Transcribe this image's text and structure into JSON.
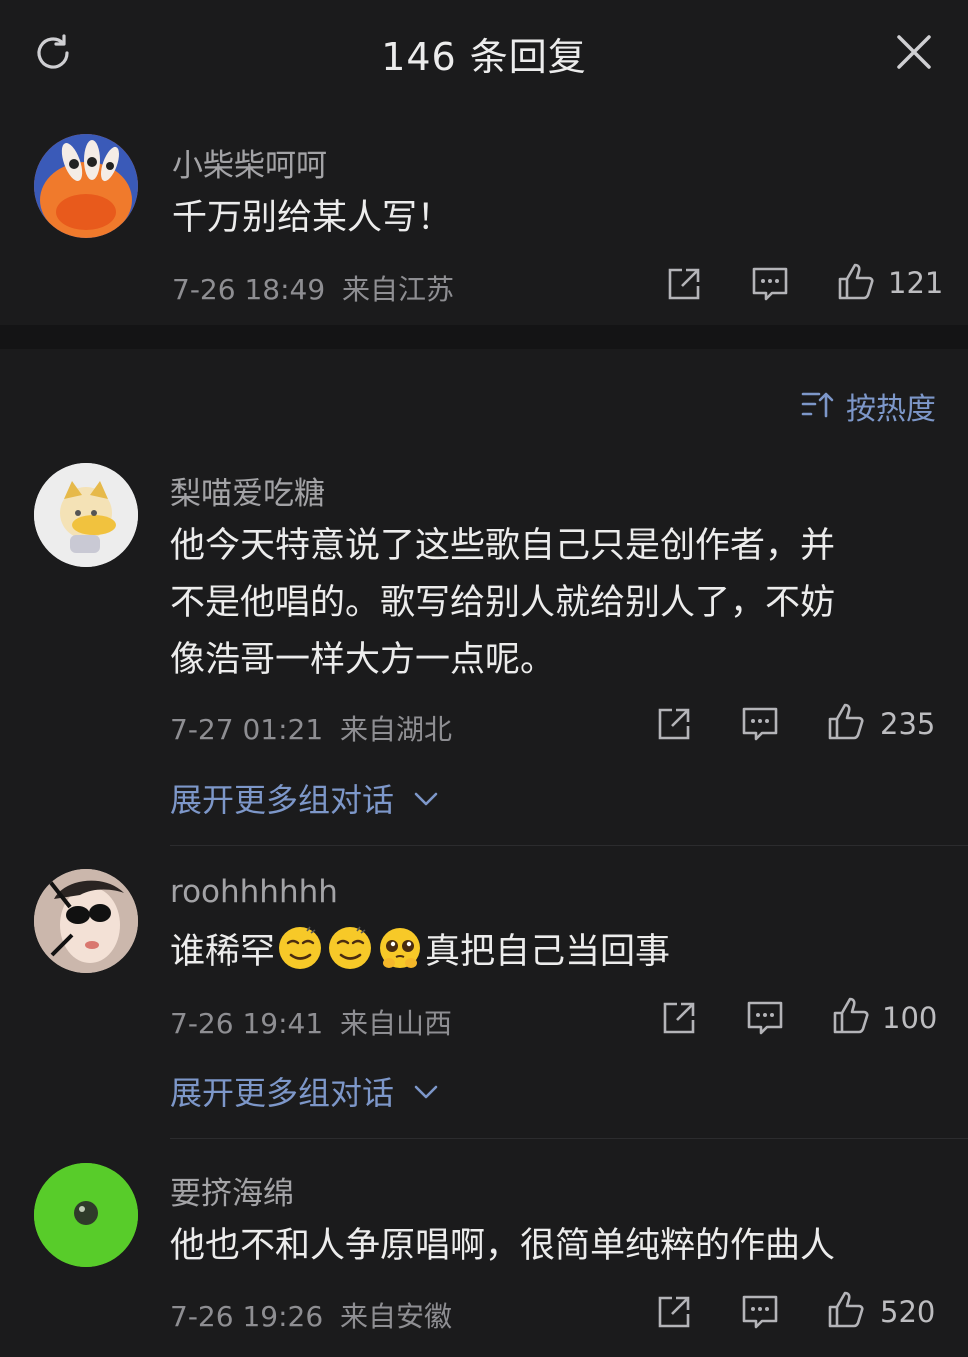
{
  "header": {
    "title": "146 条回复"
  },
  "root_comment": {
    "username": "小柴柴呵呵",
    "content": "千万别给某人写！",
    "time": "7-26 18:49",
    "location": "来自江苏",
    "likes": "121"
  },
  "sort": {
    "label": "按热度"
  },
  "replies": [
    {
      "username": "梨喵爱吃糖",
      "content_lines": [
        "他今天特意说了这些歌自己只是创作者，并",
        "不是他唱的。歌写给别人就给别人了，不妨",
        "像浩哥一样大方一点呢。"
      ],
      "time": "7-27 01:21",
      "location": "来自湖北",
      "likes": "235",
      "expand": "展开更多组对话"
    },
    {
      "username": "roohhhhhh",
      "content_pre": "谁稀罕",
      "content_post": "真把自己当回事",
      "time": "7-26 19:41",
      "location": "来自山西",
      "likes": "100",
      "expand": "展开更多组对话"
    },
    {
      "username": "要挤海绵",
      "content": "他也不和人争原唱啊，很简单纯粹的作曲人",
      "time": "7-26 19:26",
      "location": "来自安徽",
      "likes": "520"
    }
  ],
  "icons": [
    "refresh-icon",
    "close-icon",
    "share-icon",
    "comment-icon",
    "like-icon",
    "sort-icon",
    "chevron-down-icon"
  ],
  "colors": {
    "background": "#1b1b1c",
    "link": "#7d97c9",
    "text": "#ececec",
    "secondary": "#8e8e92"
  }
}
